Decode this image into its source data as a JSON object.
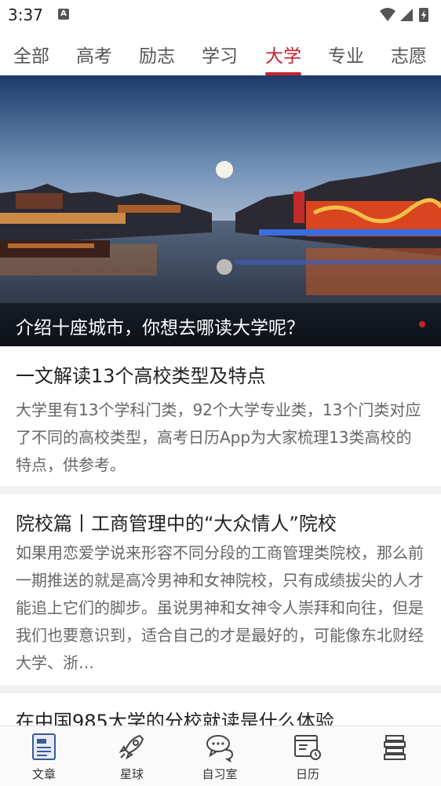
{
  "status_bar": {
    "time": "3:37",
    "notification_icon_letter": "A",
    "icons": [
      "wifi-icon",
      "signal-icon",
      "battery-charging-icon"
    ]
  },
  "tabs": [
    {
      "label": "全部",
      "active": false
    },
    {
      "label": "高考",
      "active": false
    },
    {
      "label": "励志",
      "active": false
    },
    {
      "label": "学习",
      "active": false
    },
    {
      "label": "大学",
      "active": true
    },
    {
      "label": "专业",
      "active": false
    },
    {
      "label": "志愿",
      "active": false
    }
  ],
  "hero": {
    "caption": "介绍十座城市，你想去哪读大学呢？"
  },
  "articles": [
    {
      "title": "一文解读13个高校类型及特点",
      "summary": "大学里有13个学科门类，92个大学专业类，13个门类对应了不同的高校类型，高考日历App为大家梳理13类高校的特点，供参考。"
    },
    {
      "title": "院校篇丨工商管理中的“大众情人”院校",
      "summary": "如果用恋爱学说来形容不同分段的工商管理类院校，那么前一期推送的就是高冷男神和女神院校，只有成绩拔尖的人才能追上它们的脚步。虽说男神和女神令人崇拜和向往，但是我们也要意识到，适合自己的才是最好的，可能像东北财经大学、浙…"
    },
    {
      "title": "在中国985大学的分校就读是什么体验",
      "summary": ""
    }
  ],
  "bottom_nav": [
    {
      "label": "文章",
      "icon": "article-icon"
    },
    {
      "label": "星球",
      "icon": "rocket-icon"
    },
    {
      "label": "自习室",
      "icon": "chat-bubbles-icon"
    },
    {
      "label": "日历",
      "icon": "calendar-icon"
    },
    {
      "label": "",
      "icon": "books-icon"
    }
  ],
  "colors": {
    "accent": "#c8232c",
    "text": "#222222",
    "summary_text": "#666666"
  }
}
